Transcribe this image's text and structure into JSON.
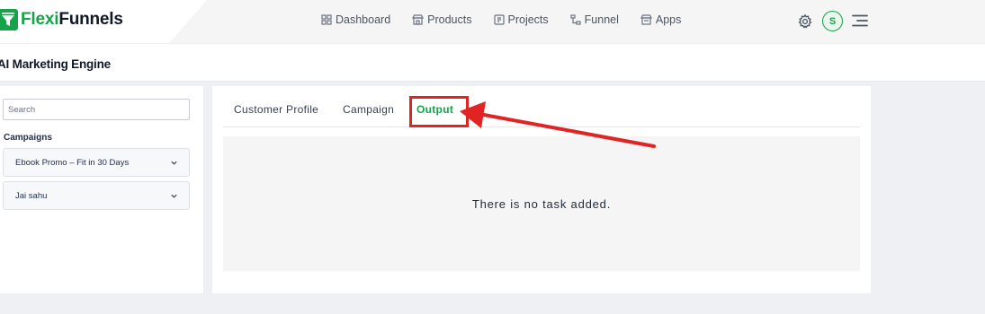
{
  "brand": {
    "part1": "Flexi",
    "part2": "Funnels",
    "accent": "#16a34a"
  },
  "nav": {
    "items": [
      {
        "label": "Dashboard",
        "icon": "grid-icon"
      },
      {
        "label": "Products",
        "icon": "shop-icon"
      },
      {
        "label": "Projects",
        "icon": "project-icon"
      },
      {
        "label": "Funnel",
        "icon": "funnel-icon"
      },
      {
        "label": "Apps",
        "icon": "apps-icon"
      }
    ],
    "avatar_letter": "S"
  },
  "page": {
    "title": "AI Marketing Engine"
  },
  "sidebar": {
    "search_placeholder": "Search",
    "section_label": "Campaigns",
    "campaigns": [
      {
        "name": "Ebook Promo – Fit in 30 Days"
      },
      {
        "name": "Jai sahu"
      }
    ]
  },
  "tabs": [
    {
      "label": "Customer Profile",
      "active": false
    },
    {
      "label": "Campaign",
      "active": false
    },
    {
      "label": "Output",
      "active": true
    }
  ],
  "empty_state": {
    "message": "There is no task added."
  },
  "colors": {
    "highlight": "#e02424",
    "accent": "#16a34a"
  }
}
